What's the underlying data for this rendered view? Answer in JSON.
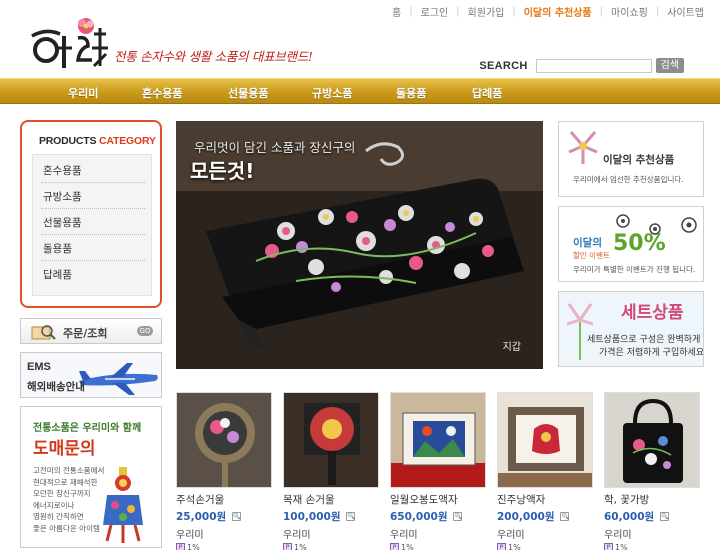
{
  "top_links": [
    "홈",
    "로그인",
    "회원가입",
    "이달의 추천상품",
    "마이쇼핑",
    "사이트맵"
  ],
  "logo": {
    "text": "우리美",
    "slogan": "전통 손자수와 생활 소품의 대표브랜드!"
  },
  "search": {
    "label": "SEARCH",
    "value": "",
    "button": "검색"
  },
  "nav": [
    "우리미",
    "혼수용품",
    "선물용품",
    "규방소품",
    "돌용품",
    "답례품"
  ],
  "category": {
    "title_a": "PRODUCTS",
    "title_b": "CATEGORY",
    "items": [
      "혼수용품",
      "규방소품",
      "선물용품",
      "돌용품",
      "답례품"
    ]
  },
  "order": {
    "label": "주문/조회",
    "go": "GO"
  },
  "ems": {
    "title": "EMS",
    "subtitle": "해외배송안내"
  },
  "wholesale": {
    "line1": "전통소품은 우리미와 함께",
    "line2": "도매문의",
    "desc": [
      "고전미의 전통소품에서",
      "현대적으로 재해석한",
      "모던한 장신구까지",
      "에너지로이나",
      "영원히 간직하면",
      "좋은 아름다운 아이템"
    ]
  },
  "hero": {
    "line1": "우리멋이 담긴 소품과 장신구의",
    "line2": "모든것!",
    "caption": "지갑"
  },
  "right_banners": [
    {
      "title": "이달의 추천상품",
      "desc": "우리미에서 엄선한 추천상품입니다."
    },
    {
      "title_a": "이달의",
      "title_b": "할인 이벤트",
      "big": "50%",
      "desc": "우리미가 특별한 이벤트가 진행 됩니다."
    },
    {
      "title": "세트상품",
      "desc": [
        "세트상품으로 구성은 완벽하게",
        "가격은 저렴하게 구입하세요"
      ]
    }
  ],
  "products": [
    {
      "name": "주석손거울",
      "price": "25,000원",
      "brand": "우리미",
      "point": "1%"
    },
    {
      "name": "목재 손거울",
      "price": "100,000원",
      "brand": "우리미",
      "point": "1%"
    },
    {
      "name": "일월오봉도액자",
      "price": "650,000원",
      "brand": "우리미",
      "point": "1%"
    },
    {
      "name": "진주낭액자",
      "price": "200,000원",
      "brand": "우리미",
      "point": "1%"
    },
    {
      "name": "학, 꽃가방",
      "price": "60,000원",
      "brand": "우리미",
      "point": "1%"
    }
  ],
  "colors": {
    "nav_gold": "#c99a1a",
    "accent_red": "#e0502a",
    "price_blue": "#2a5fb0",
    "highlight_orange": "#e07a12"
  }
}
